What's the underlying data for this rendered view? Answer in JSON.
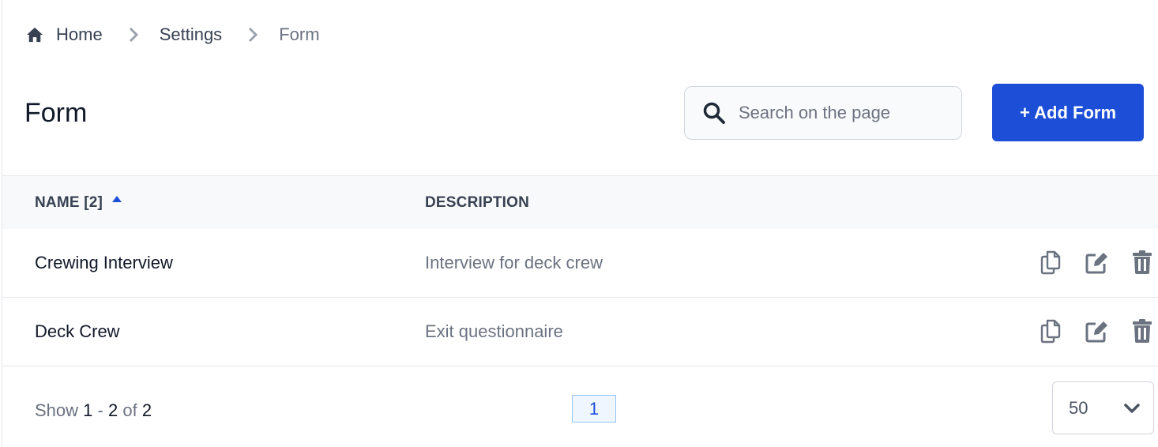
{
  "breadcrumb": {
    "items": [
      {
        "label": "Home",
        "icon": "home-icon"
      },
      {
        "label": "Settings"
      },
      {
        "label": "Form"
      }
    ],
    "separator_icon": "chevron-right-icon"
  },
  "header": {
    "title": "Form",
    "search": {
      "placeholder": "Search on the page",
      "value": "",
      "icon": "search-icon"
    },
    "add_button_label": "+ Add Form"
  },
  "colors": {
    "accent": "#1d4ed8",
    "text_primary": "#111827",
    "text_secondary": "#6b7280",
    "icon": "#6b7280"
  },
  "table": {
    "columns": [
      {
        "label": "NAME [2]",
        "sorted": "ascending"
      },
      {
        "label": "DESCRIPTION"
      }
    ],
    "rows": [
      {
        "name": "Crewing Interview",
        "description": "Interview for deck crew"
      },
      {
        "name": "Deck Crew",
        "description": "Exit questionnaire"
      }
    ],
    "row_actions": [
      "copy-icon",
      "edit-icon",
      "trash-icon"
    ]
  },
  "footer": {
    "show_prefix": "Show",
    "range_start": "1",
    "range_sep": "-",
    "range_end": "2",
    "of_label": "of",
    "total": "2",
    "current_page": "1",
    "per_page": "50"
  }
}
